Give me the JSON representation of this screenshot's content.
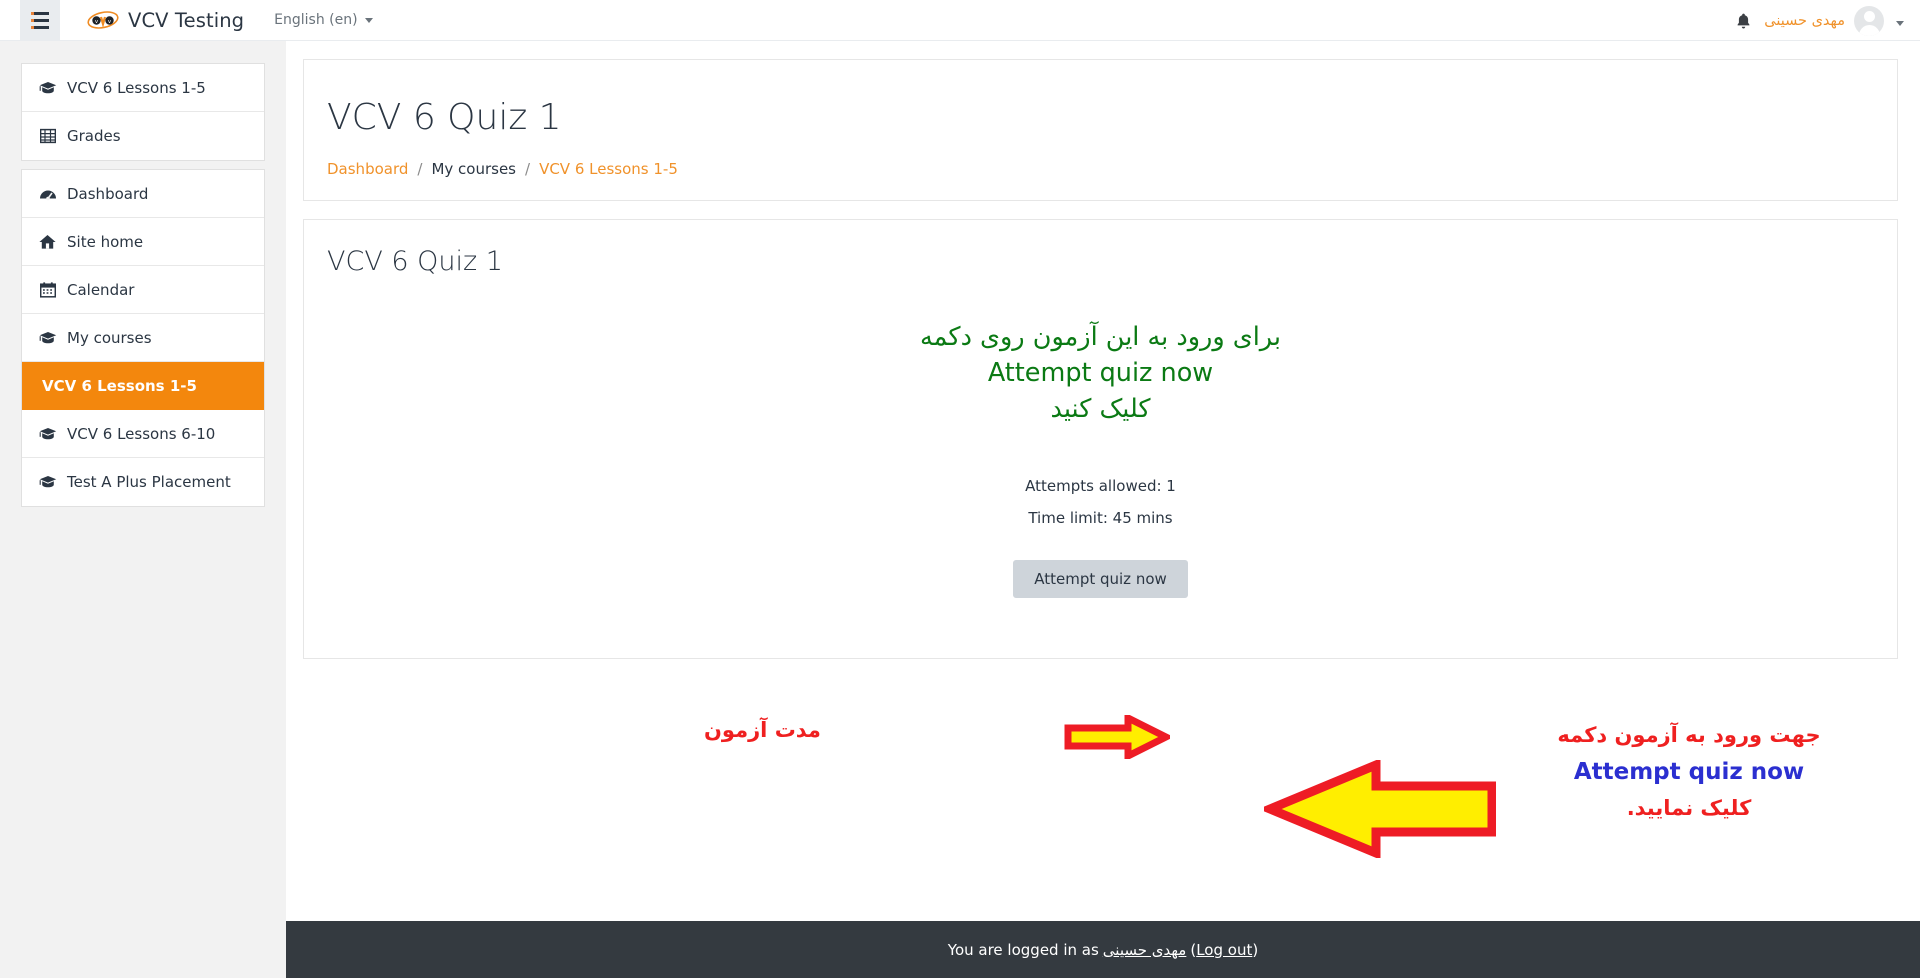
{
  "navbar": {
    "menu_toggle_name": "hamburger-menu",
    "brand_name": "VCV Testing",
    "brand_logo_text": "VCV",
    "language": "English (en)",
    "user_name": "مهدی حسینی"
  },
  "sidebar": {
    "blocks": [
      {
        "items": [
          {
            "label": "VCV 6 Lessons 1-5",
            "icon": "graduation-cap-icon",
            "active": false
          },
          {
            "label": "Grades",
            "icon": "grades-table-icon",
            "active": false
          }
        ]
      },
      {
        "items": [
          {
            "label": "Dashboard",
            "icon": "dashboard-gauge-icon",
            "active": false
          },
          {
            "label": "Site home",
            "icon": "home-icon",
            "active": false
          },
          {
            "label": "Calendar",
            "icon": "calendar-icon",
            "active": false
          },
          {
            "label": "My courses",
            "icon": "graduation-cap-icon",
            "active": false
          },
          {
            "label": "VCV 6 Lessons 1-5",
            "icon": "none",
            "active": true
          },
          {
            "label": "VCV 6 Lessons 6-10",
            "icon": "graduation-cap-icon",
            "active": false
          },
          {
            "label": "Test A Plus Placement",
            "icon": "graduation-cap-icon",
            "active": false
          }
        ]
      }
    ]
  },
  "header": {
    "page_title": "VCV 6 Quiz 1",
    "breadcrumb": {
      "dashboard": "Dashboard",
      "separator": "/",
      "my_courses": "My courses",
      "course": "VCV 6 Lessons 1-5"
    }
  },
  "quiz": {
    "section_title": "VCV 6 Quiz 1",
    "green_note_line1": "برای ورود به این آزمون روی دکمه",
    "green_note_line2": "Attempt quiz now",
    "green_note_line3": "کلیک کنید",
    "attempts_allowed": "Attempts allowed: 1",
    "time_limit": "Time limit: 45 mins",
    "attempt_button": "Attempt quiz now"
  },
  "annotations": {
    "left_label": "مدت آزمون",
    "right_line1": "جهت ورود به آزمون دکمه",
    "right_line2": "Attempt quiz now",
    "right_line3": "کلیک نمایید."
  },
  "footer": {
    "logged_in_prefix": "You are logged in as",
    "user_name": "مهدی حسینی",
    "open_paren": "(",
    "logout": "Log out",
    "close_paren": ")"
  },
  "colors": {
    "brand_orange": "#f0922b",
    "active_orange": "#f3870d",
    "green_note": "#0b7a14",
    "annotation_red": "#ef2020",
    "annotation_blue": "#2b2fd0",
    "arrow_fill": "#ffee00",
    "arrow_stroke": "#ee1c25",
    "footer_bg": "#343a40"
  }
}
